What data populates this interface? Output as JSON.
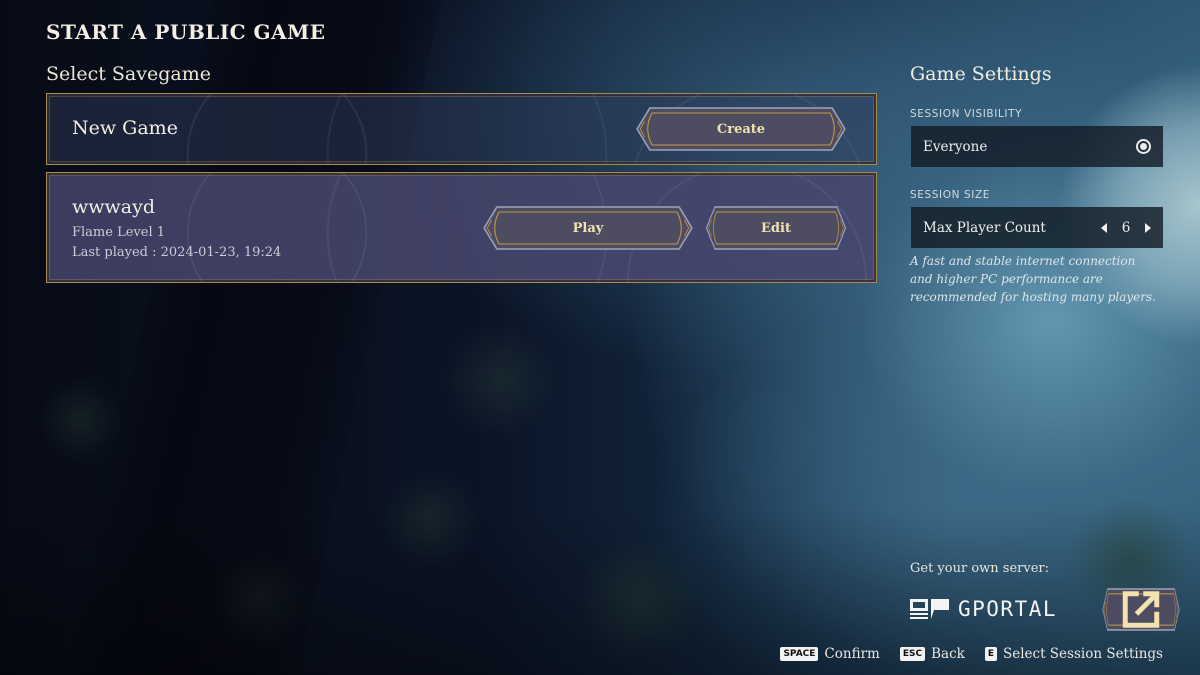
{
  "page": {
    "title": "START A PUBLIC GAME",
    "section_title": "Select Savegame"
  },
  "savegames": {
    "new_game": {
      "title": "New Game",
      "create_label": "Create"
    },
    "items": [
      {
        "name": "wwwayd",
        "level": "Flame Level 1",
        "last_played": "Last played : 2024-01-23, 19:24",
        "play_label": "Play",
        "edit_label": "Edit"
      }
    ]
  },
  "settings": {
    "title": "Game Settings",
    "visibility": {
      "label": "SESSION VISIBILITY",
      "value": "Everyone",
      "icon": "radio-selected-icon"
    },
    "size": {
      "label": "SESSION SIZE",
      "field_label": "Max Player Count",
      "value": "6",
      "left_icon": "caret-left-icon",
      "right_icon": "caret-right-icon"
    },
    "note": "A fast and stable internet connection and higher PC performance are recommended for hosting many players."
  },
  "server": {
    "label": "Get your own server:",
    "brand": "GPORTAL",
    "button_icon": "external-link-icon"
  },
  "hints": [
    {
      "key": "SPACE",
      "label": "Confirm"
    },
    {
      "key": "ESC",
      "label": "Back"
    },
    {
      "key": "E",
      "label": "Select Session Settings"
    }
  ],
  "colors": {
    "gold_accent": "#a88b4e",
    "button_text": "#f1e2b0",
    "selected_card": "#44456a"
  }
}
